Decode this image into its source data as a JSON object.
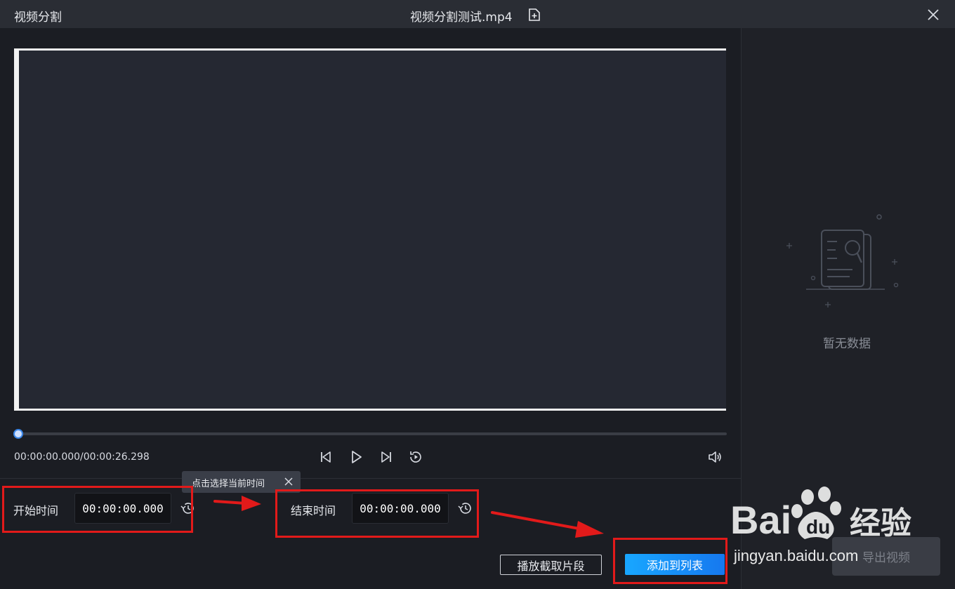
{
  "titlebar": {
    "app_title": "视频分割",
    "file_title": "视频分割测试.mp4"
  },
  "player": {
    "time_readout": "00:00:00.000/00:00:26.298",
    "progress_fraction": 0.0
  },
  "tooltip": {
    "text": "点击选择当前时间"
  },
  "range": {
    "start_label": "开始时间",
    "start_value": "00:00:00.000",
    "end_label": "结束时间",
    "end_value": "00:00:00.000"
  },
  "actions": {
    "play_clip_label": "播放截取片段",
    "add_to_list_label": "添加到列表",
    "export_label": "导出视频"
  },
  "sidepanel": {
    "empty_text": "暂无数据"
  },
  "watermark": {
    "text": "jingyan.baidu.com"
  },
  "colors": {
    "accent": "#1890ff",
    "annotation_red": "#e21a1a"
  }
}
